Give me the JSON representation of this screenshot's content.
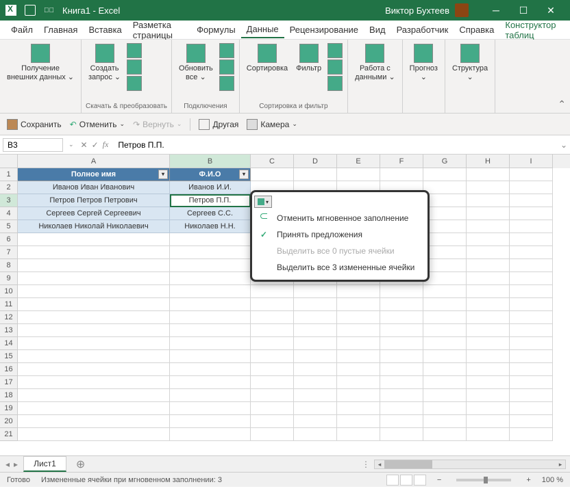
{
  "titlebar": {
    "title": "Книга1 - Excel",
    "user": "Виктор Бухтеев"
  },
  "menubar": {
    "tabs": [
      "Файл",
      "Главная",
      "Вставка",
      "Разметка страницы",
      "Формулы",
      "Данные",
      "Рецензирование",
      "Вид",
      "Разработчик",
      "Справка"
    ],
    "active_index": 5,
    "extra": "Конструктор таблиц"
  },
  "ribbon": {
    "groups": [
      {
        "label": "",
        "buttons": [
          {
            "label": "Получение\nвнешних данных ⌄"
          }
        ]
      },
      {
        "label": "Скачать & преобразовать",
        "buttons": [
          {
            "label": "Создать\nзапрос ⌄"
          }
        ]
      },
      {
        "label": "Подключения",
        "buttons": [
          {
            "label": "Обновить\nвсе ⌄"
          }
        ]
      },
      {
        "label": "Сортировка и фильтр",
        "buttons": [
          {
            "label": "Сортировка"
          },
          {
            "label": "Фильтр"
          }
        ]
      },
      {
        "label": "",
        "buttons": [
          {
            "label": "Работа с\nданными ⌄"
          }
        ]
      },
      {
        "label": "",
        "buttons": [
          {
            "label": "Прогноз\n⌄"
          }
        ]
      },
      {
        "label": "",
        "buttons": [
          {
            "label": "Структура\n⌄"
          }
        ]
      }
    ]
  },
  "quickbar": {
    "save": "Сохранить",
    "undo": "Отменить",
    "redo": "Вернуть",
    "other": "Другая",
    "camera": "Камера"
  },
  "formula_bar": {
    "name_box": "B3",
    "formula": "Петров П.П."
  },
  "columns": [
    "A",
    "B",
    "C",
    "D",
    "E",
    "F",
    "G",
    "H",
    "I"
  ],
  "selected_col_index": 1,
  "selected_row": 3,
  "table": {
    "headers": [
      "Полное имя",
      "Ф.И.О"
    ],
    "rows": [
      [
        "Иванов Иван Иванович",
        "Иванов И.И."
      ],
      [
        "Петров Петров Петрович",
        "Петров П.П."
      ],
      [
        "Сергеев Сергей Сергеевич",
        "Сергеев С.С."
      ],
      [
        "Николаев Николай Николаевич",
        "Николаев Н.Н."
      ]
    ],
    "selected_cell": {
      "row": 1,
      "col": 1
    }
  },
  "context_menu": {
    "items": [
      {
        "icon": "undo",
        "label": "Отменить мгновенное заполнение",
        "disabled": false
      },
      {
        "icon": "check",
        "label": "Принять предложения",
        "disabled": false
      },
      {
        "icon": "",
        "label": "Выделить все 0 пустые ячейки",
        "disabled": true
      },
      {
        "icon": "",
        "label": "Выделить все 3 измененные ячейки",
        "disabled": false
      }
    ]
  },
  "sheet_tabs": {
    "active": "Лист1"
  },
  "statusbar": {
    "ready": "Готово",
    "info": "Измененные ячейки при мгновенном заполнении: 3",
    "zoom": "100 %"
  }
}
